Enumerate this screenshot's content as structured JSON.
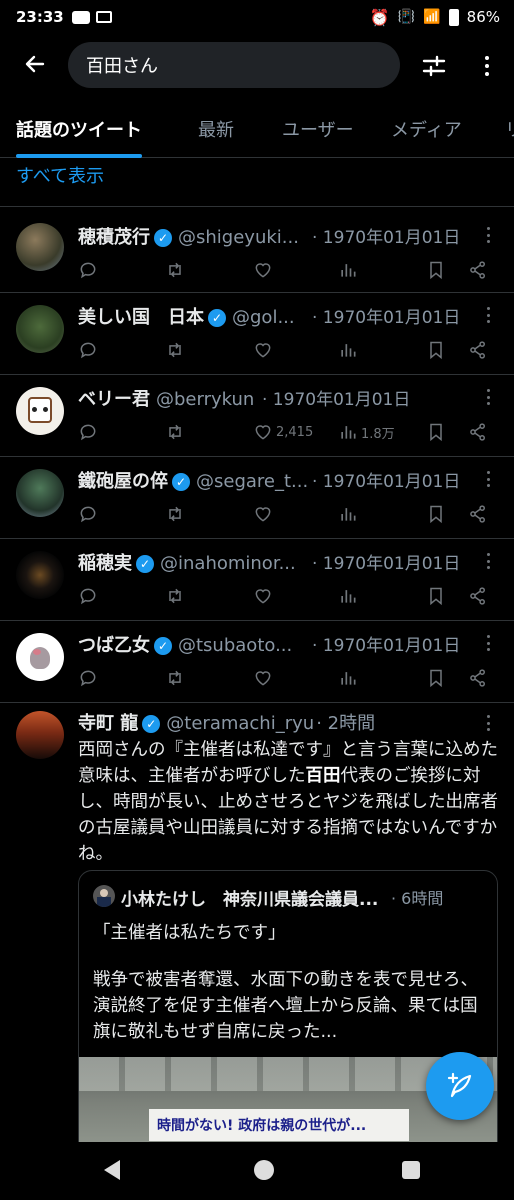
{
  "status_bar": {
    "time": "23:33",
    "battery": "86%"
  },
  "header": {
    "search_value": "百田さん"
  },
  "tabs": [
    {
      "label": "話題のツイート",
      "active": true
    },
    {
      "label": "最新"
    },
    {
      "label": "ユーザー"
    },
    {
      "label": "メディア"
    },
    {
      "label": "リ"
    }
  ],
  "show_all": "すべて表示",
  "tweets": [
    {
      "name": "穂積茂行",
      "verified": true,
      "handle": "@shigeyuki...",
      "date": "· 1970年01月01日"
    },
    {
      "name": "美しい国　日本",
      "verified": true,
      "handle": "@gol...",
      "date": "· 1970年01月01日"
    },
    {
      "name": "ベリー君",
      "verified": false,
      "handle": "@berrykun",
      "date": "· 1970年01月01日",
      "likes": "2,415",
      "views": "1.8万"
    },
    {
      "name": "鐵砲屋の倅",
      "verified": true,
      "handle": "@segare_t...",
      "date": "· 1970年01月01日"
    },
    {
      "name": "稲穂実",
      "verified": true,
      "handle": "@inahominor...",
      "date": "· 1970年01月01日"
    },
    {
      "name": "つば乙女",
      "verified": true,
      "handle": "@tsubaoto...",
      "date": "· 1970年01月01日"
    }
  ],
  "main_tweet": {
    "name": "寺町 龍",
    "handle": "@teramachi_ryu",
    "time": "· 2時間",
    "body_before": "西岡さんの『主催者は私達です』と言う言葉に込めた意味は、主催者がお呼びした",
    "body_highlight": "百田",
    "body_after": "代表のご挨拶に対し、時間が長い、止めさせろとヤジを飛ばした出席者の古屋議員や山田議員に対する指摘ではないんですかね。"
  },
  "quote": {
    "name": "小林たけし　神奈川県議会議員...",
    "time": "· 6時間",
    "line1": "「主催者は私たちです」",
    "body": "戦争で被害者奪還、水面下の動きを表で見せろ、演説終了を促す主催者へ壇上から反論、果ては国旗に敬礼もせず自席に戻った...",
    "image_banner": "時間がない! 政府は親の世代が..."
  },
  "colors": {
    "accent": "#1d9bf0",
    "bg": "#000000",
    "muted": "#71767b"
  }
}
